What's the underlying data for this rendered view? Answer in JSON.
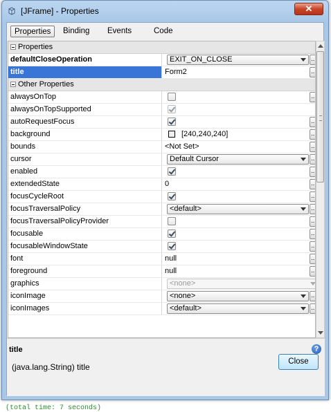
{
  "window": {
    "title": "[JFrame] - Properties",
    "close_symbol": "✕"
  },
  "tabs": [
    {
      "label": "Properties",
      "active": true
    },
    {
      "label": "Binding"
    },
    {
      "label": "Events"
    },
    {
      "label": "Code"
    }
  ],
  "rows": [
    {
      "kind": "cat",
      "name": "Properties"
    },
    {
      "kind": "combo",
      "name": "defaultCloseOperation",
      "value": "EXIT_ON_CLOSE",
      "bold": true,
      "ellipsis": true
    },
    {
      "kind": "text",
      "name": "title",
      "value": "Form2",
      "selected": true,
      "ellipsis": true
    },
    {
      "kind": "cat",
      "name": "Other Properties"
    },
    {
      "kind": "check",
      "name": "alwaysOnTop",
      "checked": false,
      "ellipsis": true
    },
    {
      "kind": "check",
      "name": "alwaysOnTopSupported",
      "checked": true,
      "disabled": true
    },
    {
      "kind": "check",
      "name": "autoRequestFocus",
      "checked": true,
      "ellipsis": true
    },
    {
      "kind": "color",
      "name": "background",
      "value": "[240,240,240]",
      "ellipsis": true
    },
    {
      "kind": "text",
      "name": "bounds",
      "value": "<Not Set>",
      "ellipsis": true
    },
    {
      "kind": "combo",
      "name": "cursor",
      "value": "Default Cursor",
      "ellipsis": true
    },
    {
      "kind": "check",
      "name": "enabled",
      "checked": true,
      "ellipsis": true
    },
    {
      "kind": "text",
      "name": "extendedState",
      "value": "0",
      "ellipsis": true
    },
    {
      "kind": "check",
      "name": "focusCycleRoot",
      "checked": true,
      "ellipsis": true
    },
    {
      "kind": "combo",
      "name": "focusTraversalPolicy",
      "value": "<default>",
      "ellipsis": true
    },
    {
      "kind": "check",
      "name": "focusTraversalPolicyProvider",
      "checked": false,
      "ellipsis": true
    },
    {
      "kind": "check",
      "name": "focusable",
      "checked": true,
      "ellipsis": true
    },
    {
      "kind": "check",
      "name": "focusableWindowState",
      "checked": true,
      "ellipsis": true
    },
    {
      "kind": "text",
      "name": "font",
      "value": "null",
      "ellipsis": true
    },
    {
      "kind": "text",
      "name": "foreground",
      "value": "null",
      "ellipsis": true
    },
    {
      "kind": "combo",
      "name": "graphics",
      "value": "<none>",
      "disabled": true
    },
    {
      "kind": "combo",
      "name": "iconImage",
      "value": "<none>",
      "ellipsis": true
    },
    {
      "kind": "combo",
      "name": "iconImages",
      "value": "<default>",
      "ellipsis": true
    }
  ],
  "help": {
    "title": "title",
    "body": "(java.lang.String) title",
    "icon": "?"
  },
  "buttons": {
    "close": "Close",
    "ellipsis": "..."
  },
  "console": {
    "text": "(total time: 7 seconds)"
  }
}
